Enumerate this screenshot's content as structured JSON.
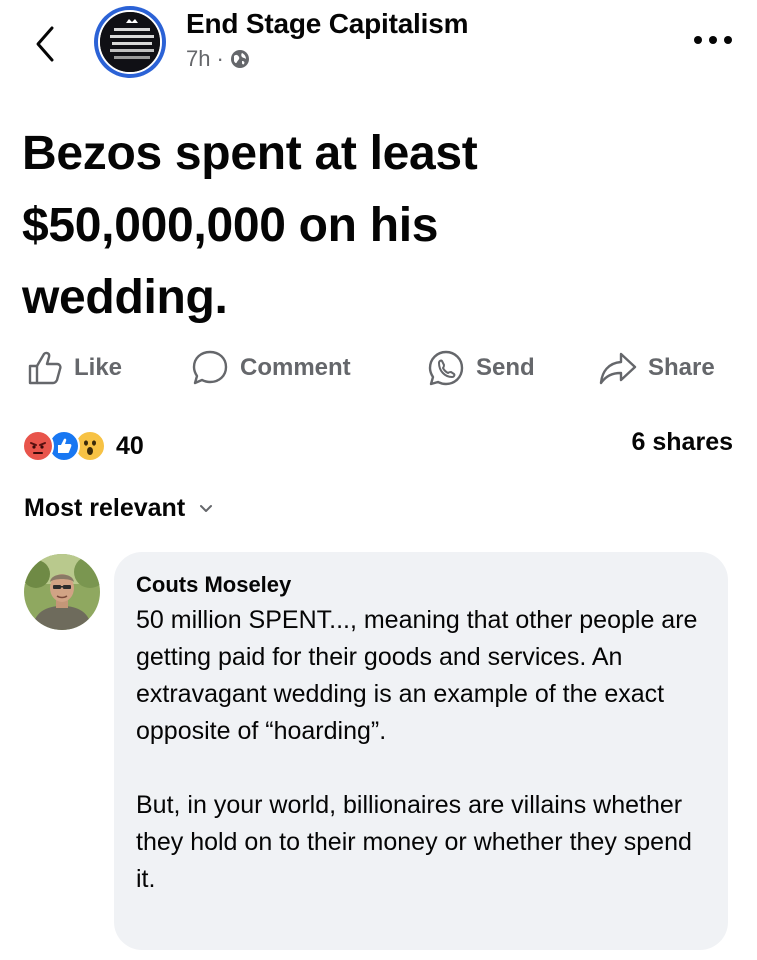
{
  "post": {
    "page_name": "End Stage Capitalism",
    "time": "7h",
    "separator": "·",
    "headline": "Bezos spent at least $50,000,000 on his wedding."
  },
  "actions": {
    "like": "Like",
    "comment": "Comment",
    "send": "Send",
    "share": "Share"
  },
  "engagement": {
    "reaction_count": "40",
    "reactions": [
      "angry-emoji",
      "like-emoji",
      "wow-emoji"
    ],
    "shares": "6 shares"
  },
  "comments": {
    "sort_label": "Most relevant",
    "items": [
      {
        "author": "Couts Moseley",
        "text_paragraph_1": "50 million SPENT..., meaning that other people are getting paid for their goods and services. An extravagant wedding is an example of the exact opposite of “hoarding”.",
        "text_paragraph_2": "But, in your world, billionaires are villains whether they hold on to their money or whether they spend it."
      }
    ]
  },
  "icons": {
    "back": "chevron-left-icon",
    "more": "more-dots-icon",
    "privacy": "globe-icon",
    "like": "thumbs-up-icon",
    "comment": "speech-bubble-icon",
    "send": "messenger-icon",
    "share": "share-arrow-icon",
    "sort": "chevron-down-icon"
  },
  "colors": {
    "text_primary": "#050505",
    "text_secondary": "#65676b",
    "comment_bg": "#f0f2f5",
    "avatar_ring": "#2b62d6",
    "like_blue": "#1877f2",
    "angry_red": "#e8544b",
    "wow_yellow": "#f7c244"
  }
}
